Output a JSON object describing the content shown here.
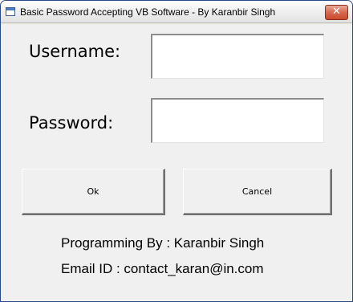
{
  "window": {
    "title": "Basic Password Accepting VB Software - By Karanbir Singh",
    "close_glyph": "✕"
  },
  "form": {
    "username_label": "Username:",
    "username_value": "",
    "password_label": "Password:",
    "password_value": "",
    "ok_label": "Ok",
    "cancel_label": "Cancel"
  },
  "footer": {
    "programming_by": "Programming By : Karanbir Singh",
    "email": "Email ID : contact_karan@in.com"
  },
  "colors": {
    "window_bg": "#f0f0f0",
    "close_button": "#d8694f"
  }
}
